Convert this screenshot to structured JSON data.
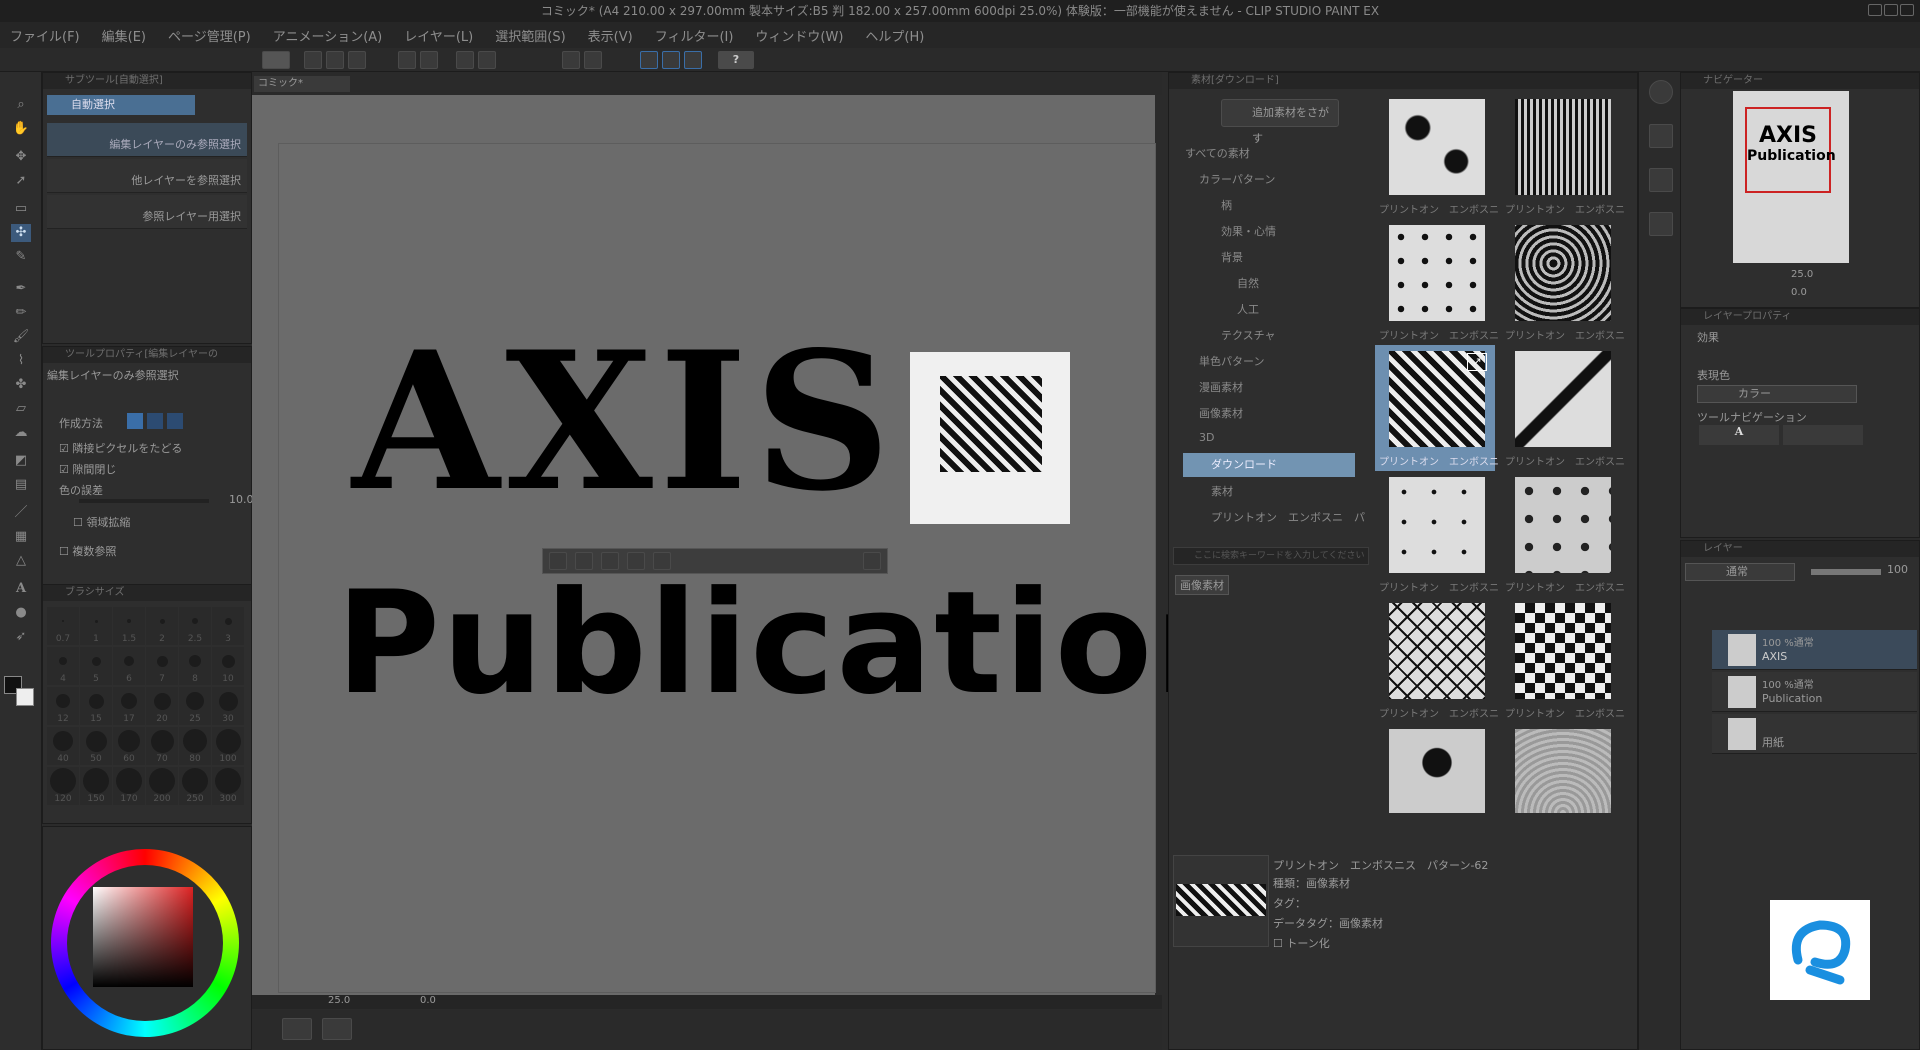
{
  "window": {
    "title": "コミック* (A4 210.00 x 297.00mm 製本サイズ:B5 判 182.00 x 257.00mm 600dpi 25.0%)  体験版：一部機能が使えません - CLIP STUDIO PAINT EX"
  },
  "menu": [
    "ファイル(F)",
    "編集(E)",
    "ページ管理(P)",
    "アニメーション(A)",
    "レイヤー(L)",
    "選択範囲(S)",
    "表示(V)",
    "フィルター(I)",
    "ウィンドウ(W)",
    "ヘルプ(H)"
  ],
  "subtool": {
    "header": "サブツール[自動選択]",
    "tab": "自動選択",
    "items": [
      "編集レイヤーのみ参照選択",
      "他レイヤーを参照選択",
      "参照レイヤー用選択"
    ]
  },
  "toolprop": {
    "header": "ツールプロパティ[編集レイヤーの",
    "name": "編集レイヤーのみ参照選択",
    "mode_label": "作成方法",
    "opt1": "隣接ピクセルをたどる",
    "opt2": "隙間閉じ",
    "tol_label": "色の誤差",
    "tol_value": "10.0",
    "expand": "領域拡縮",
    "multi": "複数参照"
  },
  "brushsize": {
    "header": "ブラシサイズ",
    "sizes": [
      "0.7",
      "1",
      "1.5",
      "2",
      "2.5",
      "3",
      "4",
      "5",
      "6",
      "7",
      "8",
      "10",
      "12",
      "15",
      "17",
      "20",
      "25",
      "30",
      "40",
      "50",
      "60",
      "70",
      "80",
      "100",
      "120",
      "150",
      "170",
      "200",
      "250",
      "300"
    ]
  },
  "canvas": {
    "tab": "コミック*",
    "line1": "AXIS",
    "line2": "Publication",
    "zoom": "25.0",
    "angle": "0.0"
  },
  "material": {
    "header": "素材[ダウンロード]",
    "search_btn": "追加素材をさがす",
    "tree": [
      "すべての素材",
      "カラーパターン",
      "柄",
      "効果・心情",
      "背景",
      "自然",
      "人工",
      "テクスチャ",
      "単色パターン",
      "漫画素材",
      "画像素材",
      "3D",
      "ダウンロード",
      "素材",
      "プリントオン　エンボスニ　パ"
    ],
    "search_placeholder": "ここに検索キーワードを入力してください",
    "tag": "画像素材",
    "item_label": "プリントオン　エンボスニス　パター",
    "detail": {
      "name": "プリントオン　エンボスニス　パターン-62",
      "type": "種類：画像素材",
      "tag": "タグ：",
      "datatag": "データタグ：画像素材",
      "tone": "トーン化"
    }
  },
  "navigator": {
    "header": "ナビゲーター",
    "thumb_line1": "AXIS",
    "thumb_line2": "Publication",
    "zoom": "25.0",
    "angle": "0.0"
  },
  "layerprop": {
    "header": "レイヤープロパティ",
    "effect": "効果",
    "color_label": "表現色",
    "color_value": "カラー",
    "toolnav": "ツールナビゲーション"
  },
  "layers": {
    "header": "レイヤー",
    "blend": "通常",
    "opacity": "100",
    "rows": [
      {
        "meta": "100 %通常",
        "name": "AXIS"
      },
      {
        "meta": "100 %通常",
        "name": "Publication"
      },
      {
        "meta": "",
        "name": "用紙"
      }
    ]
  }
}
